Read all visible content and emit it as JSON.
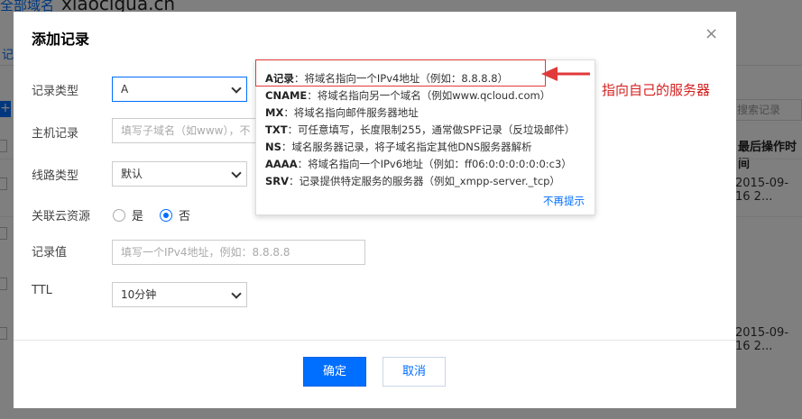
{
  "background": {
    "breadcrumb": "全部域名",
    "domain": "xiaocigua.cn",
    "tab": "记",
    "search_placeholder": "搜索记录",
    "column_header": "最后操作时间",
    "row_times": [
      "2015-09-16 2...",
      "2015-09-16 2..."
    ]
  },
  "modal": {
    "title": "添加记录",
    "close": "×",
    "fields": {
      "record_type": {
        "label": "记录类型",
        "value": "A"
      },
      "host": {
        "label": "主机记录",
        "placeholder": "填写子域名（如www），不"
      },
      "line": {
        "label": "线路类型",
        "value": "默认"
      },
      "cloud": {
        "label": "关联云资源",
        "option_yes": "是",
        "option_no": "否",
        "selected": "否"
      },
      "value": {
        "label": "记录值",
        "placeholder": "填写一个IPv4地址，例如：8.8.8.8"
      },
      "ttl": {
        "label": "TTL",
        "value": "10分钟"
      }
    },
    "confirm": "确定",
    "cancel": "取消"
  },
  "tooltip": {
    "lines": [
      {
        "key": "A记录",
        "text": "：将域名指向一个IPv4地址（例如：8.8.8.8）"
      },
      {
        "key": "CNAME",
        "text": "：将域名指向另一个域名（例如www.qcloud.com）"
      },
      {
        "key": "MX",
        "text": "：将域名指向邮件服务器地址"
      },
      {
        "key": "TXT",
        "text": "：可任意填写，长度限制255，通常做SPF记录（反垃圾邮件）"
      },
      {
        "key": "NS",
        "text": "：域名服务器记录，将子域名指定其他DNS服务器解析"
      },
      {
        "key": "AAAA",
        "text": "：将域名指向一个IPv6地址（例如：ff06:0:0:0:0:0:0:c3）"
      },
      {
        "key": "SRV",
        "text": "：记录提供特定服务的服务器（例如_xmpp-server._tcp）"
      }
    ],
    "dismiss": "不再提示"
  },
  "annotation": {
    "text": "指向自己的服务器",
    "color": "#d42020"
  },
  "colors": {
    "accent": "#006eff",
    "annotation_red": "#e03a3a"
  }
}
